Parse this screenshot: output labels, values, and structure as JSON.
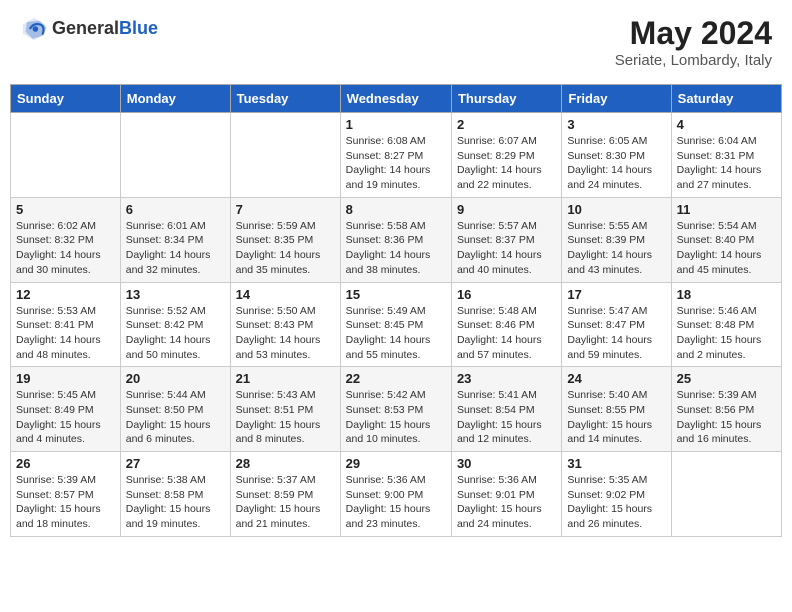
{
  "header": {
    "logo_general": "General",
    "logo_blue": "Blue",
    "month_year": "May 2024",
    "location": "Seriate, Lombardy, Italy"
  },
  "days_of_week": [
    "Sunday",
    "Monday",
    "Tuesday",
    "Wednesday",
    "Thursday",
    "Friday",
    "Saturday"
  ],
  "weeks": [
    [
      {
        "day": "",
        "sunrise": "",
        "sunset": "",
        "daylight": ""
      },
      {
        "day": "",
        "sunrise": "",
        "sunset": "",
        "daylight": ""
      },
      {
        "day": "",
        "sunrise": "",
        "sunset": "",
        "daylight": ""
      },
      {
        "day": "1",
        "sunrise": "Sunrise: 6:08 AM",
        "sunset": "Sunset: 8:27 PM",
        "daylight": "Daylight: 14 hours and 19 minutes."
      },
      {
        "day": "2",
        "sunrise": "Sunrise: 6:07 AM",
        "sunset": "Sunset: 8:29 PM",
        "daylight": "Daylight: 14 hours and 22 minutes."
      },
      {
        "day": "3",
        "sunrise": "Sunrise: 6:05 AM",
        "sunset": "Sunset: 8:30 PM",
        "daylight": "Daylight: 14 hours and 24 minutes."
      },
      {
        "day": "4",
        "sunrise": "Sunrise: 6:04 AM",
        "sunset": "Sunset: 8:31 PM",
        "daylight": "Daylight: 14 hours and 27 minutes."
      }
    ],
    [
      {
        "day": "5",
        "sunrise": "Sunrise: 6:02 AM",
        "sunset": "Sunset: 8:32 PM",
        "daylight": "Daylight: 14 hours and 30 minutes."
      },
      {
        "day": "6",
        "sunrise": "Sunrise: 6:01 AM",
        "sunset": "Sunset: 8:34 PM",
        "daylight": "Daylight: 14 hours and 32 minutes."
      },
      {
        "day": "7",
        "sunrise": "Sunrise: 5:59 AM",
        "sunset": "Sunset: 8:35 PM",
        "daylight": "Daylight: 14 hours and 35 minutes."
      },
      {
        "day": "8",
        "sunrise": "Sunrise: 5:58 AM",
        "sunset": "Sunset: 8:36 PM",
        "daylight": "Daylight: 14 hours and 38 minutes."
      },
      {
        "day": "9",
        "sunrise": "Sunrise: 5:57 AM",
        "sunset": "Sunset: 8:37 PM",
        "daylight": "Daylight: 14 hours and 40 minutes."
      },
      {
        "day": "10",
        "sunrise": "Sunrise: 5:55 AM",
        "sunset": "Sunset: 8:39 PM",
        "daylight": "Daylight: 14 hours and 43 minutes."
      },
      {
        "day": "11",
        "sunrise": "Sunrise: 5:54 AM",
        "sunset": "Sunset: 8:40 PM",
        "daylight": "Daylight: 14 hours and 45 minutes."
      }
    ],
    [
      {
        "day": "12",
        "sunrise": "Sunrise: 5:53 AM",
        "sunset": "Sunset: 8:41 PM",
        "daylight": "Daylight: 14 hours and 48 minutes."
      },
      {
        "day": "13",
        "sunrise": "Sunrise: 5:52 AM",
        "sunset": "Sunset: 8:42 PM",
        "daylight": "Daylight: 14 hours and 50 minutes."
      },
      {
        "day": "14",
        "sunrise": "Sunrise: 5:50 AM",
        "sunset": "Sunset: 8:43 PM",
        "daylight": "Daylight: 14 hours and 53 minutes."
      },
      {
        "day": "15",
        "sunrise": "Sunrise: 5:49 AM",
        "sunset": "Sunset: 8:45 PM",
        "daylight": "Daylight: 14 hours and 55 minutes."
      },
      {
        "day": "16",
        "sunrise": "Sunrise: 5:48 AM",
        "sunset": "Sunset: 8:46 PM",
        "daylight": "Daylight: 14 hours and 57 minutes."
      },
      {
        "day": "17",
        "sunrise": "Sunrise: 5:47 AM",
        "sunset": "Sunset: 8:47 PM",
        "daylight": "Daylight: 14 hours and 59 minutes."
      },
      {
        "day": "18",
        "sunrise": "Sunrise: 5:46 AM",
        "sunset": "Sunset: 8:48 PM",
        "daylight": "Daylight: 15 hours and 2 minutes."
      }
    ],
    [
      {
        "day": "19",
        "sunrise": "Sunrise: 5:45 AM",
        "sunset": "Sunset: 8:49 PM",
        "daylight": "Daylight: 15 hours and 4 minutes."
      },
      {
        "day": "20",
        "sunrise": "Sunrise: 5:44 AM",
        "sunset": "Sunset: 8:50 PM",
        "daylight": "Daylight: 15 hours and 6 minutes."
      },
      {
        "day": "21",
        "sunrise": "Sunrise: 5:43 AM",
        "sunset": "Sunset: 8:51 PM",
        "daylight": "Daylight: 15 hours and 8 minutes."
      },
      {
        "day": "22",
        "sunrise": "Sunrise: 5:42 AM",
        "sunset": "Sunset: 8:53 PM",
        "daylight": "Daylight: 15 hours and 10 minutes."
      },
      {
        "day": "23",
        "sunrise": "Sunrise: 5:41 AM",
        "sunset": "Sunset: 8:54 PM",
        "daylight": "Daylight: 15 hours and 12 minutes."
      },
      {
        "day": "24",
        "sunrise": "Sunrise: 5:40 AM",
        "sunset": "Sunset: 8:55 PM",
        "daylight": "Daylight: 15 hours and 14 minutes."
      },
      {
        "day": "25",
        "sunrise": "Sunrise: 5:39 AM",
        "sunset": "Sunset: 8:56 PM",
        "daylight": "Daylight: 15 hours and 16 minutes."
      }
    ],
    [
      {
        "day": "26",
        "sunrise": "Sunrise: 5:39 AM",
        "sunset": "Sunset: 8:57 PM",
        "daylight": "Daylight: 15 hours and 18 minutes."
      },
      {
        "day": "27",
        "sunrise": "Sunrise: 5:38 AM",
        "sunset": "Sunset: 8:58 PM",
        "daylight": "Daylight: 15 hours and 19 minutes."
      },
      {
        "day": "28",
        "sunrise": "Sunrise: 5:37 AM",
        "sunset": "Sunset: 8:59 PM",
        "daylight": "Daylight: 15 hours and 21 minutes."
      },
      {
        "day": "29",
        "sunrise": "Sunrise: 5:36 AM",
        "sunset": "Sunset: 9:00 PM",
        "daylight": "Daylight: 15 hours and 23 minutes."
      },
      {
        "day": "30",
        "sunrise": "Sunrise: 5:36 AM",
        "sunset": "Sunset: 9:01 PM",
        "daylight": "Daylight: 15 hours and 24 minutes."
      },
      {
        "day": "31",
        "sunrise": "Sunrise: 5:35 AM",
        "sunset": "Sunset: 9:02 PM",
        "daylight": "Daylight: 15 hours and 26 minutes."
      },
      {
        "day": "",
        "sunrise": "",
        "sunset": "",
        "daylight": ""
      }
    ]
  ]
}
